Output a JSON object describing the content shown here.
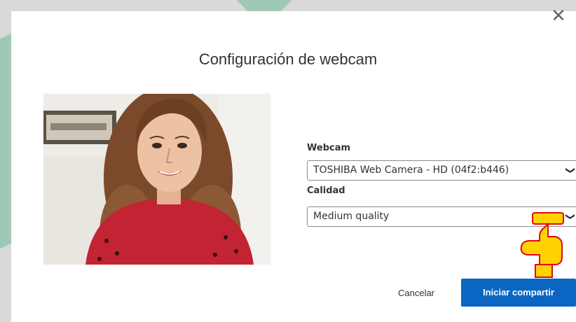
{
  "dialog": {
    "title": "Configuración de webcam",
    "close_icon": "close-icon"
  },
  "webcam": {
    "label": "Webcam",
    "selected": "TOSHIBA Web Camera - HD (04f2:b446)"
  },
  "quality": {
    "label": "Calidad",
    "selected": "Medium quality"
  },
  "actions": {
    "cancel_label": "Cancelar",
    "start_label": "Iniciar compartir"
  },
  "colors": {
    "primary": "#0a66c2",
    "accent_hand": "#ffd200",
    "hand_outline": "#e30613"
  },
  "icons": {
    "select_chevron": "chevron-down-icon",
    "pointer": "pointing-hand-icon",
    "preview": "webcam-preview-image"
  }
}
